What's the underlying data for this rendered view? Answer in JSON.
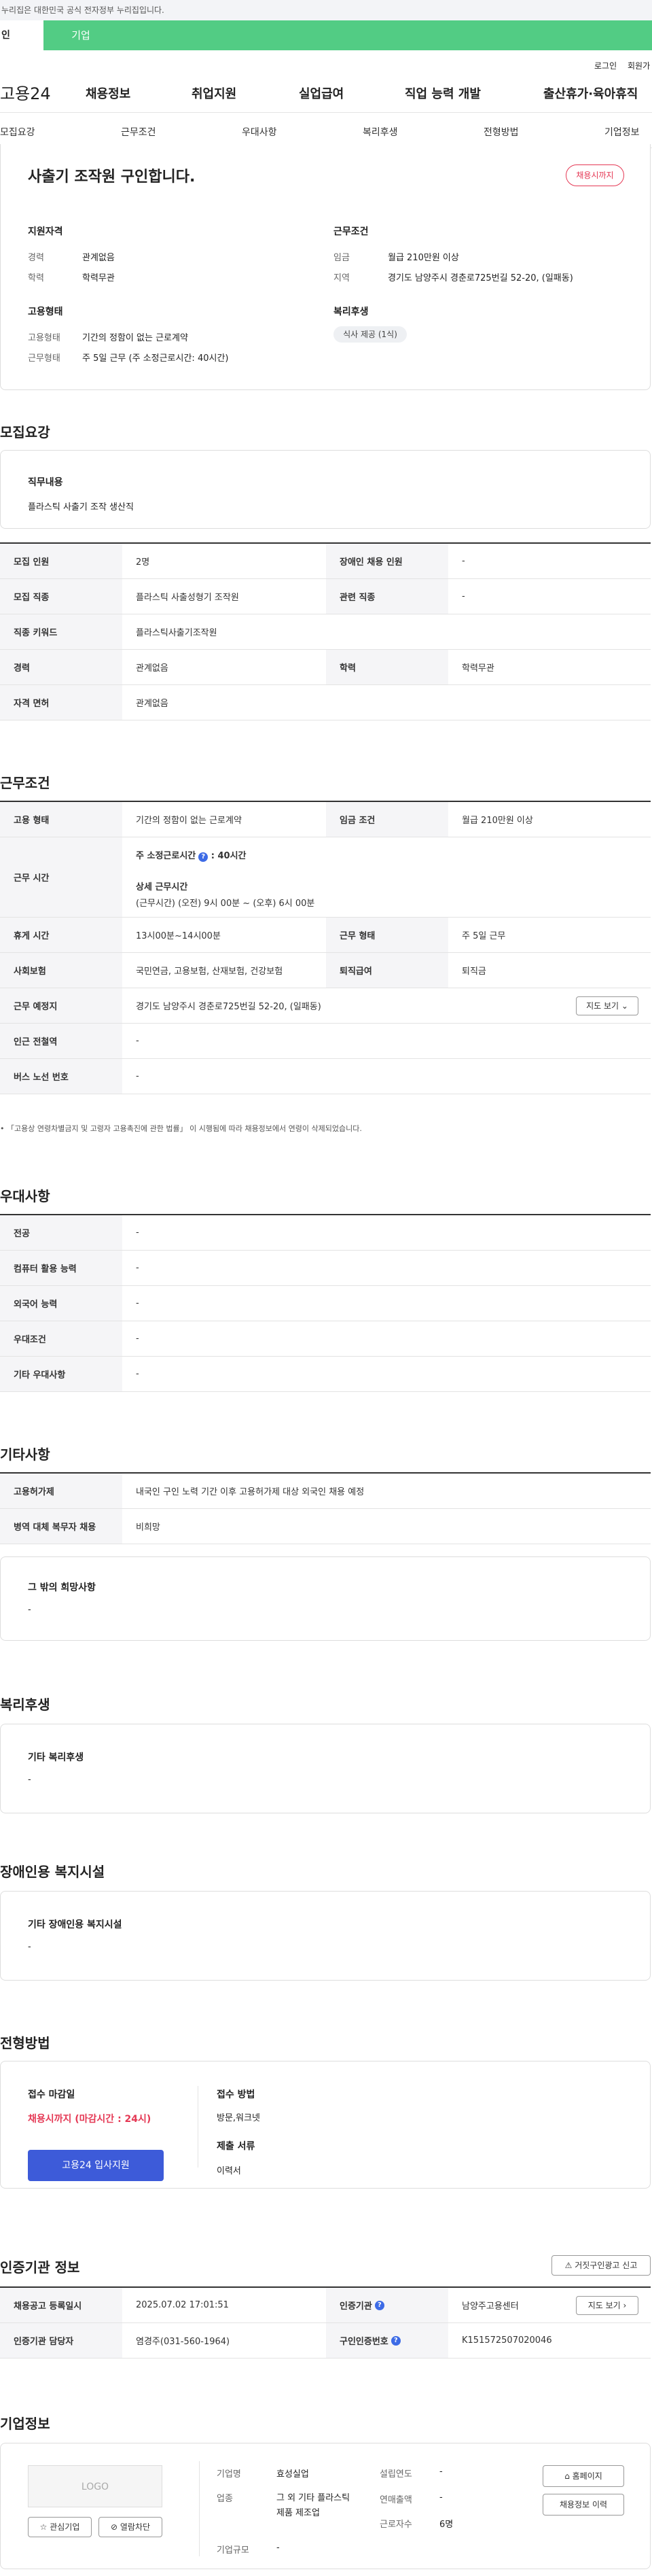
{
  "top_notice": "누리집은 대한민국 공식 전자정부 누리집입니다.",
  "user_tabs": {
    "individual": "인",
    "company": "기업"
  },
  "util": {
    "login": "로그인",
    "join": "회원가"
  },
  "header": {
    "logo": "고용24",
    "menu": [
      "채용정보",
      "취업지원",
      "실업급여",
      "직업 능력 개발",
      "출산휴가·육아휴직"
    ]
  },
  "anchor_nav": [
    "모집요강",
    "근무조건",
    "우대사항",
    "복리후생",
    "전형방법",
    "기업정보"
  ],
  "summary": {
    "title": "사출기 조작원 구인합니다.",
    "status_badge": "채용시까지",
    "qual_title": "지원자격",
    "qual": [
      {
        "label": "경력",
        "value": "관계없음"
      },
      {
        "label": "학력",
        "value": "학력무관"
      }
    ],
    "cond_title": "근무조건",
    "cond": [
      {
        "label": "임금",
        "value": "월급 210만원 이상"
      },
      {
        "label": "지역",
        "value": "경기도 남양주시 경춘로725번길 52-20, (일패동)"
      }
    ],
    "emp_title": "고용형태",
    "emp": [
      {
        "label": "고용형태",
        "value": "기간의 정함이 없는 근로계약"
      },
      {
        "label": "근무형태",
        "value": "주 5일 근무 (주 소정근로시간: 40시간)"
      }
    ],
    "welfare_title": "복리후생",
    "welfare_tag": "식사 제공 (1식)"
  },
  "recruit": {
    "heading": "모집요강",
    "duty_title": "직무내용",
    "duty": "플라스틱 사출기 조작 생산직",
    "rows": [
      [
        {
          "k": "모집 인원",
          "v": "2명"
        },
        {
          "k": "장애인 채용 인원",
          "v": "-"
        }
      ],
      [
        {
          "k": "모집 직종",
          "v": "플라스틱 사출성형기 조작원"
        },
        {
          "k": "관련 직종",
          "v": "-"
        }
      ],
      [
        {
          "k": "직종 키워드",
          "v": "플라스틱사출기조작원"
        }
      ],
      [
        {
          "k": "경력",
          "v": "관계없음"
        },
        {
          "k": "학력",
          "v": "학력무관"
        }
      ],
      [
        {
          "k": "자격 면허",
          "v": "관계없음"
        }
      ]
    ]
  },
  "work": {
    "heading": "근무조건",
    "emp_type_k": "고용 형태",
    "emp_type_v": "기간의 정함이 없는 근로계약",
    "wage_k": "임금 조건",
    "wage_v": "월급 210만원 이상",
    "hours_k": "근무 시간",
    "hours_main_label": "주 소정근로시간",
    "hours_main_value": ": 40시간",
    "hours_detail_label": "상세 근무시간",
    "hours_detail": "(근무시간) (오전) 9시 00분 ~ (오후) 6시 00분",
    "rest_k": "휴게 시간",
    "rest_v": "13시00분~14시00분",
    "form_k": "근무 형태",
    "form_v": "주 5일 근무",
    "ins_k": "사회보험",
    "ins_v": "국민연금, 고용보험, 산재보험, 건강보험",
    "ret_k": "퇴직급여",
    "ret_v": "퇴직금",
    "place_k": "근무 예정지",
    "place_v": "경기도 남양주시 경춘로725번길 52-20, (일패동)",
    "map_btn": "지도 보기",
    "station_k": "인근 전철역",
    "station_v": "-",
    "bus_k": "버스 노선 번호",
    "bus_v": "-",
    "notice": "「고용상 연령차별금지 및 고령자 고용촉진에 관한 법률」 이 시행됨에 따라 채용정보에서 연령이 삭제되었습니다."
  },
  "pref": {
    "heading": "우대사항",
    "rows": [
      {
        "k": "전공",
        "v": "-"
      },
      {
        "k": "컴퓨터 활용 능력",
        "v": "-"
      },
      {
        "k": "외국어 능력",
        "v": "-"
      },
      {
        "k": "우대조건",
        "v": "-"
      },
      {
        "k": "기타 우대사항",
        "v": "-"
      }
    ]
  },
  "etc": {
    "heading": "기타사항",
    "rows": [
      {
        "k": "고용허가제",
        "v": "내국인 구인 노력 기간 이후 고용허가제 대상 외국인 채용 예정"
      },
      {
        "k": "병역 대체 복무자 채용",
        "v": "비희망"
      }
    ],
    "wish_title": "그 밖의 희망사항",
    "wish_value": "-"
  },
  "benefit": {
    "heading": "복리후생",
    "title": "기타 복리후생",
    "value": "-"
  },
  "disability": {
    "heading": "장애인용 복지시설",
    "title": "기타 장애인용 복지시설",
    "value": "-"
  },
  "process": {
    "heading": "전형방법",
    "deadline_title": "접수 마감일",
    "deadline_value": "채용시까지 (마감시간 : 24시)",
    "apply_btn": "고용24 입사지원",
    "method_title": "접수 방법",
    "method_value": "방문,워크넷",
    "docs_title": "제출 서류",
    "docs_value": "이력서"
  },
  "cert": {
    "heading": "인증기관 정보",
    "report_btn": "거짓구인광고 신고",
    "reg_k": "채용공고 등록일시",
    "reg_v": "2025.07.02 17:01:51",
    "org_k": "인증기관",
    "org_v": "남양주고용센터",
    "map_btn": "지도 보기",
    "mgr_k": "인증기관 담당자",
    "mgr_v": "염경주(031-560-1964)",
    "no_k": "구인인증번호",
    "no_v": "K151572507020046"
  },
  "company": {
    "heading": "기업정보",
    "logo_text": "LOGO",
    "fav_btn": "관심기업",
    "block_btn": "열람차단",
    "name_k": "기업명",
    "name_v": "효성실업",
    "ind_k": "업종",
    "ind_v": "그 외 기타 플라스틱 제품 제조업",
    "size_k": "기업규모",
    "size_v": "-",
    "year_k": "설립연도",
    "year_v": "-",
    "sales_k": "연매출액",
    "sales_v": "-",
    "emp_k": "근로자수",
    "emp_v": "6명",
    "home_btn": "홈페이지",
    "list_btn": "채용정보 이력"
  },
  "colors": {
    "green": "#52cc84",
    "blue": "#3d5bd9",
    "red": "#e53955"
  }
}
